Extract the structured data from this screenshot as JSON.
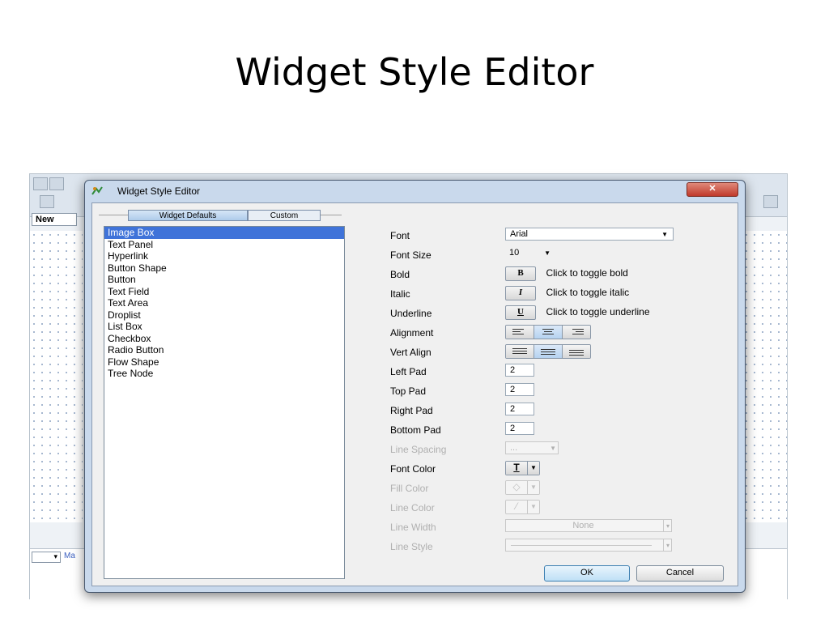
{
  "slide": {
    "title": "Widget Style Editor"
  },
  "app": {
    "tab_label": "New",
    "combo_value": "▾",
    "link_text": "Ma"
  },
  "dialog": {
    "title": "Widget Style Editor",
    "close_label": "✕",
    "tabs": [
      {
        "label": "Widget Defaults",
        "active": true
      },
      {
        "label": "Custom",
        "active": false
      }
    ],
    "widget_list": [
      "Image Box",
      "Text Panel",
      "Hyperlink",
      "Button Shape",
      "Button",
      "Text Field",
      "Text Area",
      "Droplist",
      "List Box",
      "Checkbox",
      "Radio Button",
      "Flow Shape",
      "Tree Node"
    ],
    "selected_index": 0,
    "props": {
      "font": {
        "label": "Font",
        "value": "Arial"
      },
      "font_size": {
        "label": "Font Size",
        "value": "10"
      },
      "bold": {
        "label": "Bold",
        "glyph": "B",
        "text": "Click to toggle bold"
      },
      "italic": {
        "label": "Italic",
        "glyph": "I",
        "text": "Click to toggle italic"
      },
      "underline": {
        "label": "Underline",
        "glyph": "U",
        "text": "Click to toggle underline"
      },
      "alignment": {
        "label": "Alignment",
        "selected": "center"
      },
      "vert_align": {
        "label": "Vert Align",
        "selected": "middle"
      },
      "left_pad": {
        "label": "Left Pad",
        "value": "2"
      },
      "top_pad": {
        "label": "Top Pad",
        "value": "2"
      },
      "right_pad": {
        "label": "Right Pad",
        "value": "2"
      },
      "bottom_pad": {
        "label": "Bottom Pad",
        "value": "2"
      },
      "line_spacing": {
        "label": "Line Spacing",
        "value": "..."
      },
      "font_color": {
        "label": "Font Color",
        "glyph": "T"
      },
      "fill_color": {
        "label": "Fill Color",
        "glyph": "◇"
      },
      "line_color": {
        "label": "Line Color",
        "glyph": "⁄"
      },
      "line_width": {
        "label": "Line Width",
        "value": "None"
      },
      "line_style": {
        "label": "Line Style",
        "value": ""
      }
    },
    "buttons": {
      "ok": "OK",
      "cancel": "Cancel"
    }
  },
  "colors": {
    "selection": "#3f73d9",
    "dialog_frame": "#c9d9ec",
    "close": "#c0392b"
  }
}
